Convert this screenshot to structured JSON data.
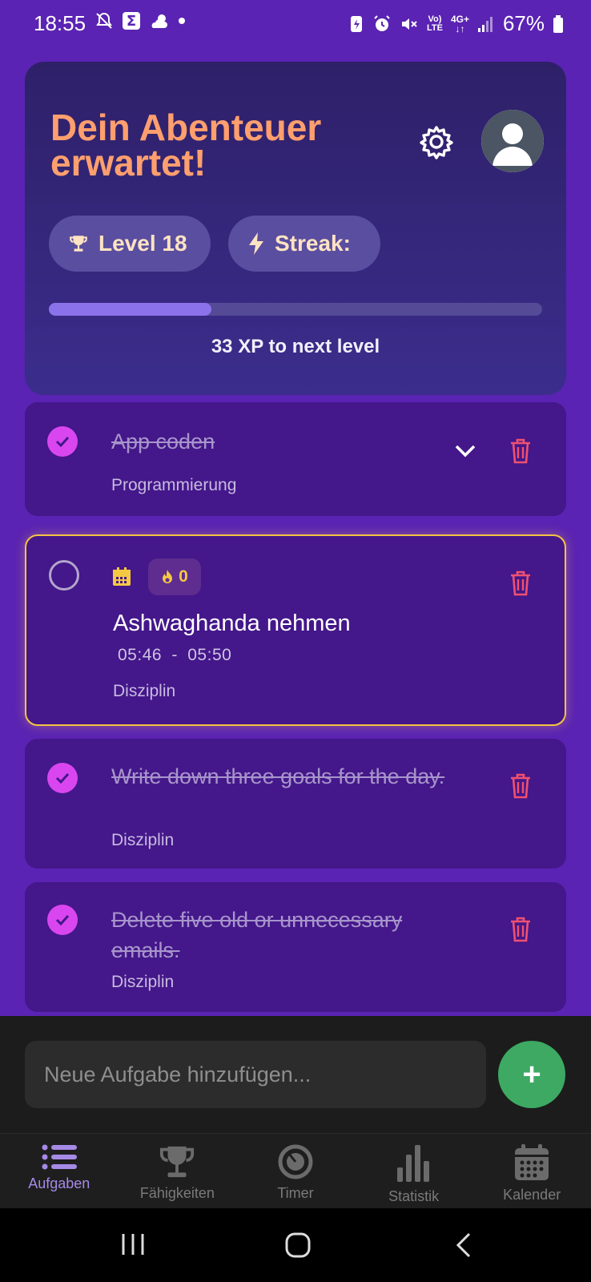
{
  "status_bar": {
    "time": "18:55",
    "battery": "67%",
    "signal_label": "4G+",
    "lte_label": "LTE"
  },
  "hero": {
    "title": "Dein Abenteuer erwartet!",
    "level_label": "Level 18",
    "streak_label": "Streak:",
    "xp_progress": 0.33,
    "xp_text": "33 XP to next level",
    "title_color": "#ff9f6e"
  },
  "tasks": [
    {
      "title": "App coden",
      "category": "Programmierung",
      "done": true
    },
    {
      "title": "Ashwaghanda nehmen",
      "category": "Disziplin",
      "done": false,
      "start_time": "05:46",
      "separator": "-",
      "end_time": "05:50",
      "streak_count": "0"
    },
    {
      "title": "Write down three goals for the day.",
      "category": "Disziplin",
      "done": true
    },
    {
      "title": "Delete five old or unnecessary emails.",
      "category": "Disziplin",
      "done": true
    }
  ],
  "new_task": {
    "placeholder": "Neue Aufgabe hinzufügen...",
    "add_label": "+"
  },
  "nav": {
    "items": [
      {
        "label": "Aufgaben",
        "icon": "list-icon",
        "active": true
      },
      {
        "label": "Fähigkeiten",
        "icon": "trophy-icon",
        "active": false
      },
      {
        "label": "Timer",
        "icon": "timer-icon",
        "active": false
      },
      {
        "label": "Statistik",
        "icon": "bar-chart-icon",
        "active": false
      },
      {
        "label": "Kalender",
        "icon": "calendar-icon",
        "active": false
      }
    ]
  },
  "colors": {
    "background": "#5a23b3",
    "card": "#44178a",
    "check_done": "#d946ef",
    "trash": "#f0506e",
    "active_border": "#f4c443",
    "add_button": "#3da962",
    "nav_active": "#a58ae6"
  }
}
